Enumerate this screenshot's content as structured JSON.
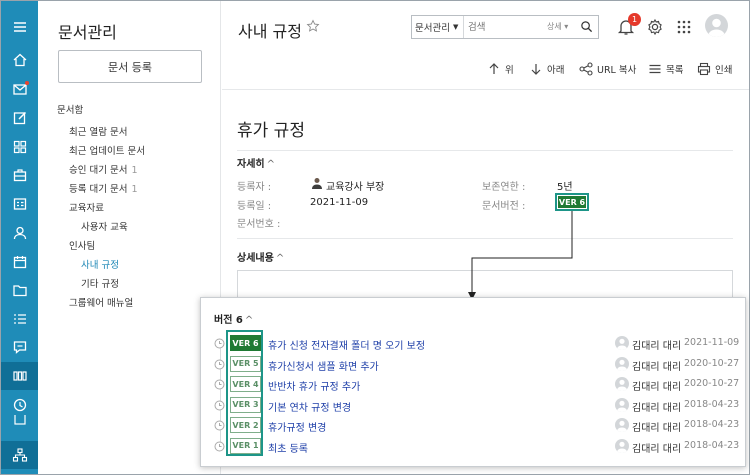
{
  "sidebar_title": "문서관리",
  "register_button": "문서 등록",
  "tree": [
    {
      "label": "문서함",
      "count": "",
      "selected": false
    },
    {
      "label": "최근 열람 문서",
      "count": "",
      "selected": false
    },
    {
      "label": "최근 업데이트 문서",
      "count": "",
      "selected": false
    },
    {
      "label": "승인 대기 문서",
      "count": "1",
      "selected": false
    },
    {
      "label": "등록 대기 문서",
      "count": "1",
      "selected": false
    },
    {
      "label": "교육자료",
      "count": "",
      "selected": false
    },
    {
      "label": "사용자 교육",
      "count": "",
      "selected": false
    },
    {
      "label": "인사팀",
      "count": "",
      "selected": false
    },
    {
      "label": "사내 규정",
      "count": "",
      "selected": true
    },
    {
      "label": "기타 규정",
      "count": "",
      "selected": false
    },
    {
      "label": "그룹웨어 매뉴얼",
      "count": "",
      "selected": false
    }
  ],
  "header": {
    "title": "사내 규정",
    "search_scope": "문서관리",
    "search_placeholder": "검색",
    "search_detail": "상세",
    "notification_count": "1"
  },
  "toolbar": {
    "up": "위",
    "down": "아래",
    "url_copy": "URL 복사",
    "list": "목록",
    "print": "인쇄"
  },
  "doc": {
    "title": "휴가 규정",
    "detail_section": "자세히",
    "registrant_label": "등록자 :",
    "registrant_value": "교육강사 부장",
    "reg_date_label": "등록일 :",
    "reg_date_value": "2021-11-09",
    "doc_no_label": "문서번호 :",
    "retention_label": "보존연한 :",
    "retention_value": "5년",
    "version_label": "문서버전 :",
    "version_value": "VER 6",
    "content_section": "상세내용"
  },
  "versions": {
    "heading": "버전 6",
    "rows": [
      {
        "tag": "VER 6",
        "title": "휴가 신청 전자결재 폴더 명 오기 보정",
        "user": "김대리 대리",
        "date": "2021-11-09",
        "current": true
      },
      {
        "tag": "VER 5",
        "title": "휴가신청서 샘플 화면 추가",
        "user": "김대리 대리",
        "date": "2020-10-27",
        "current": false
      },
      {
        "tag": "VER 4",
        "title": "반반차 휴가 규정 추가",
        "user": "김대리 대리",
        "date": "2020-10-27",
        "current": false
      },
      {
        "tag": "VER 3",
        "title": "기본 연차 규정 변경",
        "user": "김대리 대리",
        "date": "2018-04-23",
        "current": false
      },
      {
        "tag": "VER 2",
        "title": "휴가규정 변경",
        "user": "김대리 대리",
        "date": "2018-04-23",
        "current": false
      },
      {
        "tag": "VER 1",
        "title": "최초 등록",
        "user": "김대리 대리",
        "date": "2018-04-23",
        "current": false
      }
    ]
  },
  "colors": {
    "rail": "#1f8cb8",
    "rail_active": "#106f97",
    "version_green": "#1f7a34",
    "highlight_teal": "#1d9588",
    "link_blue": "#1e3fa8"
  }
}
